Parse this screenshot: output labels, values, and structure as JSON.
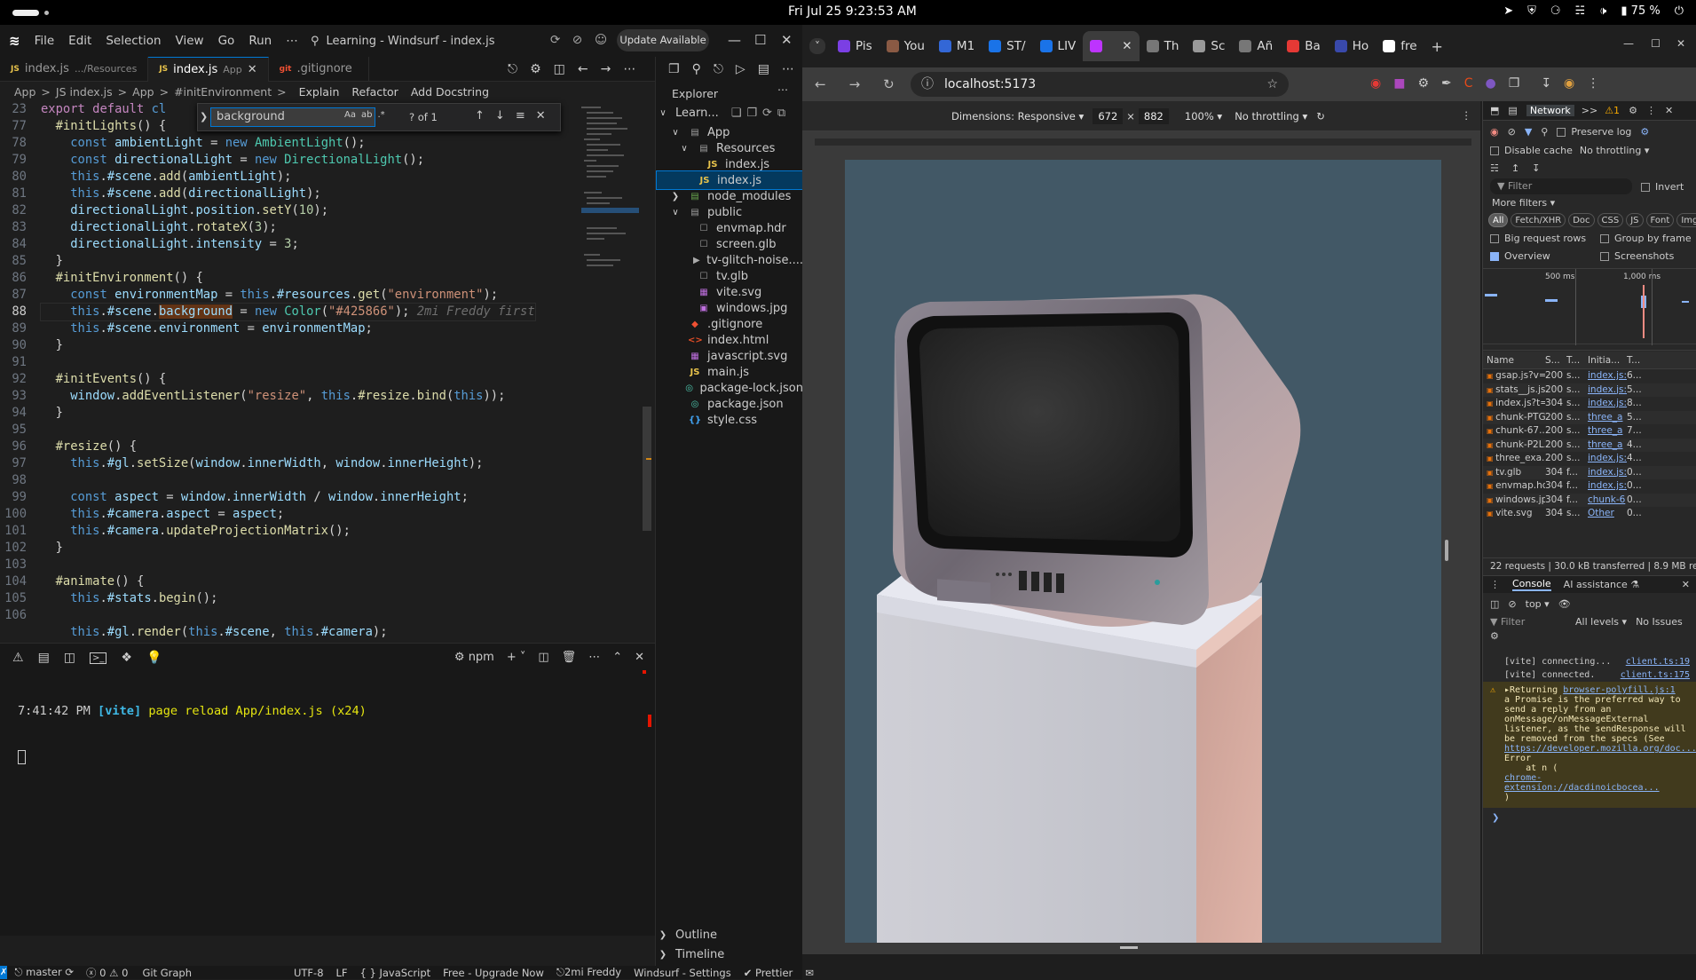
{
  "topbar": {
    "clock": "Fri Jul 25   9:23:53 AM",
    "battery": "75 %"
  },
  "editor": {
    "menu": [
      "File",
      "Edit",
      "Selection",
      "View",
      "Go",
      "Run",
      "⋯"
    ],
    "title": "Learning - Windsurf - index.js",
    "update_button": "Update Available",
    "tabs": [
      {
        "icon": "JS",
        "label": "index.js",
        "desc": ".../Resources"
      },
      {
        "icon": "JS",
        "label": "index.js",
        "desc": "App",
        "active": true
      },
      {
        "icon": "git",
        "label": ".gitignore",
        "desc": ""
      }
    ],
    "breadcrumbs": [
      "App",
      ">",
      "JS index.js",
      ">",
      "App",
      ">",
      "#initEnvironment",
      ">",
      "Explain",
      "Refactor",
      "Add Docstring"
    ],
    "find": {
      "value": "background",
      "count": "? of 1",
      "opts": [
        "Aa",
        "ab",
        ".*"
      ]
    },
    "code_lines": [
      {
        "n": "23",
        "html": "<span class='kw'>export default</span> <span class='kb'>cl</span>"
      },
      {
        "n": "77",
        "html": "  <span class='fn'>#initLights</span><span class='pl'>() {</span>"
      },
      {
        "n": "78",
        "html": "    <span class='kb'>const</span> <span class='vr'>ambientLight</span> <span class='pl'>=</span> <span class='kb'>new</span> <span class='cl'>AmbientLight</span><span class='pl'>();</span>"
      },
      {
        "n": "79",
        "html": "    <span class='kb'>const</span> <span class='vr'>directionalLight</span> <span class='pl'>=</span> <span class='kb'>new</span> <span class='cl'>DirectionalLight</span><span class='pl'>();</span>"
      },
      {
        "n": "80",
        "html": "    <span class='kb'>this</span><span class='pl'>.</span><span class='vr'>#scene</span><span class='pl'>.</span><span class='fn'>add</span><span class='pl'>(</span><span class='vr'>ambientLight</span><span class='pl'>);</span>"
      },
      {
        "n": "81",
        "html": "    <span class='kb'>this</span><span class='pl'>.</span><span class='vr'>#scene</span><span class='pl'>.</span><span class='fn'>add</span><span class='pl'>(</span><span class='vr'>directionalLight</span><span class='pl'>);</span>"
      },
      {
        "n": "82",
        "html": "    <span class='vr'>directionalLight</span><span class='pl'>.</span><span class='vr'>position</span><span class='pl'>.</span><span class='fn'>setY</span><span class='pl'>(</span><span class='nm'>10</span><span class='pl'>);</span>"
      },
      {
        "n": "83",
        "html": "    <span class='vr'>directionalLight</span><span class='pl'>.</span><span class='fn'>rotateX</span><span class='pl'>(</span><span class='nm'>3</span><span class='pl'>);</span>"
      },
      {
        "n": "84",
        "html": "    <span class='vr'>directionalLight</span><span class='pl'>.</span><span class='vr'>intensity</span> <span class='pl'>=</span> <span class='nm'>3</span><span class='pl'>;</span>"
      },
      {
        "n": "85",
        "html": "  <span class='pl'>}</span>"
      },
      {
        "n": "86",
        "html": "  <span class='fn'>#initEnvironment</span><span class='pl'>() {</span>"
      },
      {
        "n": "87",
        "html": "    <span class='kb'>const</span> <span class='vr'>environmentMap</span> <span class='pl'>=</span> <span class='kb'>this</span><span class='pl'>.</span><span class='vr'>#resources</span><span class='pl'>.</span><span class='fn'>get</span><span class='pl'>(</span><span class='st'>\"environment\"</span><span class='pl'>);</span>"
      },
      {
        "n": "88",
        "cur": true,
        "html": "    <span class='kb'>this</span><span class='pl'>.</span><span class='vr'>#scene</span><span class='pl'>.</span><span class='vr hl'>background</span> <span class='pl'>=</span> <span class='kb'>new</span> <span class='cl'>Color</span><span class='pl'>(</span><span class='st'>\"#425866\"</span><span class='pl'>);</span> <span class='gh'>2mi Freddy first</span>"
      },
      {
        "n": "89",
        "html": "    <span class='kb'>this</span><span class='pl'>.</span><span class='vr'>#scene</span><span class='pl'>.</span><span class='vr'>environment</span> <span class='pl'>=</span> <span class='vr'>environmentMap</span><span class='pl'>;</span>"
      },
      {
        "n": "90",
        "html": "  <span class='pl'>}</span>"
      },
      {
        "n": "91",
        "html": ""
      },
      {
        "n": "92",
        "html": "  <span class='fn'>#initEvents</span><span class='pl'>() {</span>"
      },
      {
        "n": "93",
        "html": "    <span class='vr'>window</span><span class='pl'>.</span><span class='fn'>addEventListener</span><span class='pl'>(</span><span class='st'>\"resize\"</span><span class='pl'>,</span> <span class='kb'>this</span><span class='pl'>.</span><span class='fn'>#resize</span><span class='pl'>.</span><span class='fn'>bind</span><span class='pl'>(</span><span class='kb'>this</span><span class='pl'>));</span>"
      },
      {
        "n": "94",
        "html": "  <span class='pl'>}</span>"
      },
      {
        "n": "95",
        "html": ""
      },
      {
        "n": "96",
        "html": "  <span class='fn'>#resize</span><span class='pl'>() {</span>"
      },
      {
        "n": "97",
        "html": "    <span class='kb'>this</span><span class='pl'>.</span><span class='vr'>#gl</span><span class='pl'>.</span><span class='fn'>setSize</span><span class='pl'>(</span><span class='vr'>window</span><span class='pl'>.</span><span class='vr'>innerWidth</span><span class='pl'>,</span> <span class='vr'>window</span><span class='pl'>.</span><span class='vr'>innerHeight</span><span class='pl'>);</span>"
      },
      {
        "n": "98",
        "html": ""
      },
      {
        "n": "99",
        "html": "    <span class='kb'>const</span> <span class='vr'>aspect</span> <span class='pl'>=</span> <span class='vr'>window</span><span class='pl'>.</span><span class='vr'>innerWidth</span> <span class='pl'>/</span> <span class='vr'>window</span><span class='pl'>.</span><span class='vr'>innerHeight</span><span class='pl'>;</span>"
      },
      {
        "n": "100",
        "html": "    <span class='kb'>this</span><span class='pl'>.</span><span class='vr'>#camera</span><span class='pl'>.</span><span class='vr'>aspect</span> <span class='pl'>=</span> <span class='vr'>aspect</span><span class='pl'>;</span>"
      },
      {
        "n": "101",
        "html": "    <span class='kb'>this</span><span class='pl'>.</span><span class='vr'>#camera</span><span class='pl'>.</span><span class='fn'>updateProjectionMatrix</span><span class='pl'>();</span>"
      },
      {
        "n": "102",
        "html": "  <span class='pl'>}</span>"
      },
      {
        "n": "103",
        "html": ""
      },
      {
        "n": "104",
        "html": "  <span class='fn'>#animate</span><span class='pl'>() {</span>"
      },
      {
        "n": "105",
        "html": "    <span class='kb'>this</span><span class='pl'>.</span><span class='vr'>#stats</span><span class='pl'>.</span><span class='fn'>begin</span><span class='pl'>();</span>"
      },
      {
        "n": "106",
        "html": ""
      },
      {
        "n": "",
        "html": "    <span class='kb'>this</span><span class='pl'>.</span><span class='vr'>#gl</span><span class='pl'>.</span><span class='fn'>render</span><span class='pl'>(</span><span class='kb'>this</span><span class='pl'>.</span><span class='vr'>#scene</span><span class='pl'>,</span> <span class='kb'>this</span><span class='pl'>.</span><span class='vr'>#camera</span><span class='pl'>);</span>"
      }
    ],
    "terminal": {
      "line_time": "7:41:42 PM ",
      "line_tag": "[vite]",
      "line_msg": " page reload App/index.js ",
      "line_count": "(x24)",
      "shell": "npm"
    },
    "explorer": {
      "title": "Explorer",
      "root": "Learn...",
      "items": [
        {
          "label": "App",
          "depth": 1,
          "kind": "folder-open"
        },
        {
          "label": "Resources",
          "depth": 2,
          "kind": "folder-open"
        },
        {
          "label": "index.js",
          "depth": 3,
          "kind": "js"
        },
        {
          "label": "index.js",
          "depth": 2,
          "kind": "js",
          "selected": true
        },
        {
          "label": "node_modules",
          "depth": 1,
          "kind": "folder"
        },
        {
          "label": "public",
          "depth": 1,
          "kind": "folder-open"
        },
        {
          "label": "envmap.hdr",
          "depth": 2,
          "kind": "file"
        },
        {
          "label": "screen.glb",
          "depth": 2,
          "kind": "file"
        },
        {
          "label": "tv-glitch-noise....",
          "depth": 2,
          "kind": "video"
        },
        {
          "label": "tv.glb",
          "depth": 2,
          "kind": "file"
        },
        {
          "label": "vite.svg",
          "depth": 2,
          "kind": "svg"
        },
        {
          "label": "windows.jpg",
          "depth": 2,
          "kind": "img"
        },
        {
          "label": ".gitignore",
          "depth": 1,
          "kind": "git"
        },
        {
          "label": "index.html",
          "depth": 1,
          "kind": "html"
        },
        {
          "label": "javascript.svg",
          "depth": 1,
          "kind": "svg"
        },
        {
          "label": "main.js",
          "depth": 1,
          "kind": "js"
        },
        {
          "label": "package-lock.json",
          "depth": 1,
          "kind": "json"
        },
        {
          "label": "package.json",
          "depth": 1,
          "kind": "json"
        },
        {
          "label": "style.css",
          "depth": 1,
          "kind": "css"
        }
      ],
      "outline": "Outline",
      "timeline": "Timeline"
    },
    "status": {
      "branch": "master",
      "problems": "ⓧ 0 ⚠ 0",
      "git_graph": "Git Graph",
      "encoding": "UTF-8",
      "eol": "LF",
      "language": "{ } JavaScript",
      "plan": "Free - Upgrade Now",
      "user": "2mi Freddy",
      "settings": "Windsurf - Settings",
      "prettier": "✔ Prettier"
    }
  },
  "browser": {
    "tabs": [
      {
        "label": "Pis",
        "color": "#7b3fe4"
      },
      {
        "label": "You",
        "color": "#8a5a44"
      },
      {
        "label": "M1",
        "color": "#3367d6"
      },
      {
        "label": "ST/",
        "color": "#1a73e8"
      },
      {
        "label": "LIV",
        "color": "#1a73e8"
      },
      {
        "label": "",
        "color": "#bd34fe",
        "active": true
      },
      {
        "label": "Th",
        "color": "#777777"
      },
      {
        "label": "Sc",
        "color": "#999999"
      },
      {
        "label": "Añ",
        "color": "#777777"
      },
      {
        "label": "Ba",
        "color": "#e53935"
      },
      {
        "label": "Ho",
        "color": "#3949ab"
      },
      {
        "label": "fre",
        "color": "#ffffff"
      }
    ],
    "url": "localhost:5173",
    "device_toolbar": {
      "dimensions": "Dimensions: Responsive",
      "width": "672",
      "height": "882",
      "zoom": "100%",
      "throttle": "No throttling"
    },
    "scene_bg": "#425866"
  },
  "devtools": {
    "tabs": [
      "Network",
      ">>",
      "⚠1"
    ],
    "preserve_log": "Preserve log",
    "disable_cache": "Disable cache",
    "throttle": "No throttling",
    "filter_placeholder": "Filter",
    "invert": "Invert",
    "more_filters": "More filters",
    "type_chips": [
      "All",
      "Fetch/XHR",
      "Doc",
      "CSS",
      "JS",
      "Font",
      "Img"
    ],
    "big_rows": "Big request rows",
    "group_frame": "Group by frame",
    "overview": "Overview",
    "screenshots": "Screenshots",
    "timeline_marks": [
      "500 ms",
      "1,000 ms"
    ],
    "columns": [
      "Name",
      "S...",
      "T...",
      "Initia...",
      "T..."
    ],
    "requests": [
      {
        "name": "gsap.js?v=...",
        "status": "200",
        "type": "s...",
        "init": "index.js:",
        "t": "6..."
      },
      {
        "name": "stats__js.js...",
        "status": "200",
        "type": "s...",
        "init": "index.js:",
        "t": "5..."
      },
      {
        "name": "index.js?t=...",
        "status": "304",
        "type": "s...",
        "init": "index.js:",
        "t": "8..."
      },
      {
        "name": "chunk-PTG...",
        "status": "200",
        "type": "s...",
        "init": "three_a",
        "t": "5..."
      },
      {
        "name": "chunk-67...",
        "status": "200",
        "type": "s...",
        "init": "three_a",
        "t": "7..."
      },
      {
        "name": "chunk-P2L...",
        "status": "200",
        "type": "s...",
        "init": "three_a",
        "t": "4..."
      },
      {
        "name": "three_exa...",
        "status": "200",
        "type": "s...",
        "init": "index.js:",
        "t": "4..."
      },
      {
        "name": "tv.glb",
        "status": "304",
        "type": "f...",
        "init": "index.js:",
        "t": "0..."
      },
      {
        "name": "envmap.hdr",
        "status": "304",
        "type": "f...",
        "init": "index.js:",
        "t": "0..."
      },
      {
        "name": "windows.jpg",
        "status": "304",
        "type": "f...",
        "init": "chunk-6",
        "t": "0..."
      },
      {
        "name": "vite.svg",
        "status": "304",
        "type": "s...",
        "init": "Other",
        "t": "0..."
      }
    ],
    "summary": "22 requests | 30.0 kB transferred | 8.9 MB re",
    "console_tabs": [
      "Console",
      "AI assistance ⚗"
    ],
    "console_ctx": "top",
    "console_levels": "All levels",
    "console_issues": "No Issues",
    "console_lines": [
      {
        "text": "[vite] connecting...",
        "link": "client.ts:19"
      },
      {
        "text": "[vite] connected.",
        "link": "client.ts:175"
      }
    ],
    "warning": {
      "prefix": "▸Returning ",
      "link": "browser-polyfill.js:1",
      "body": "a Promise is the preferred way to send a reply from an onMessage/onMessageExternal listener, as the sendResponse will be removed from the specs (See ",
      "url": "https://developer.mozilla.org/doc...",
      "tail": ") Error\n    at n (",
      "ext": "chrome-extension://dacdinoicbocea...",
      "end": ")"
    }
  }
}
